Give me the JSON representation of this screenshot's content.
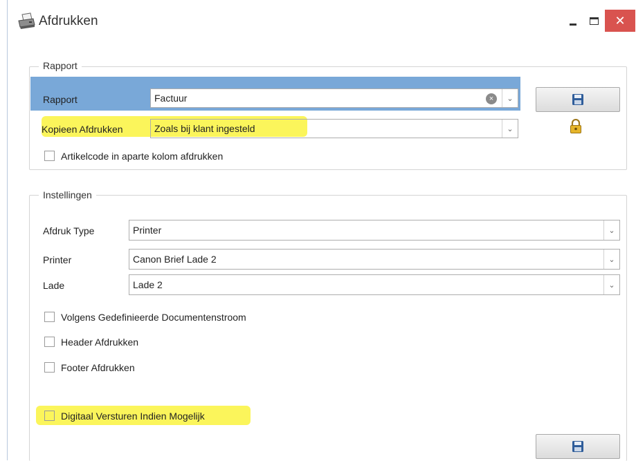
{
  "window": {
    "title": "Afdrukken",
    "icons": {
      "app": "printer-icon",
      "minimize": "minimize-icon",
      "maximize": "maximize-icon",
      "close": "close-icon"
    },
    "close_symbol": "✕"
  },
  "rapport_group": {
    "label": "Rapport",
    "rapport_label": "Rapport",
    "rapport_value": "Factuur",
    "kopieen_label": "Kopieen Afdrukken",
    "kopieen_value": "Zoals bij klant ingesteld",
    "artikelcode_label": "Artikelcode in aparte kolom afdrukken",
    "artikelcode_checked": false,
    "save_icon": "floppy-disk-icon",
    "lock_icon": "padlock-icon"
  },
  "instellingen_group": {
    "label": "Instellingen",
    "afdruk_type_label": "Afdruk Type",
    "afdruk_type_value": "Printer",
    "printer_label": "Printer",
    "printer_value": "Canon Brief Lade 2",
    "lade_label": "Lade",
    "lade_value": "Lade 2",
    "checkboxes": [
      {
        "label": "Volgens Gedefinieerde Documentenstroom",
        "checked": false
      },
      {
        "label": "Header Afdrukken",
        "checked": false
      },
      {
        "label": "Footer Afdrukken",
        "checked": false
      },
      {
        "label": "Digitaal Versturen Indien Mogelijk",
        "checked": false
      }
    ]
  },
  "colors": {
    "highlight": "#fbf55b",
    "selected_row": "#79a8d8",
    "close_button": "#d9534f"
  },
  "dropdown_glyph": "⌄"
}
